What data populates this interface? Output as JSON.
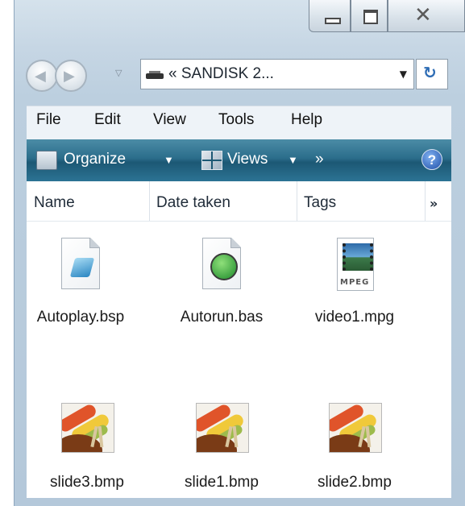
{
  "window": {
    "caption_buttons": {
      "minimize_icon": "minimize-icon",
      "maximize_icon": "maximize-icon",
      "close_icon": "close-icon"
    }
  },
  "navigation": {
    "back_icon": "back-arrow-icon",
    "forward_icon": "forward-arrow-icon",
    "address": {
      "prefix": "«",
      "location": "SANDISK 2...",
      "drive_icon": "removable-drive-icon"
    },
    "refresh_icon": "refresh-icon"
  },
  "menu": {
    "items": [
      "File",
      "Edit",
      "View",
      "Tools",
      "Help"
    ]
  },
  "toolbar": {
    "organize_label": "Organize",
    "views_label": "Views",
    "more_label": "»",
    "help_label": "?",
    "colors": {
      "gradient_top": "#4b8ca6",
      "gradient_bottom": "#1c5874"
    }
  },
  "columns": {
    "headers": [
      "Name",
      "Date taken",
      "Tags"
    ],
    "more": "»"
  },
  "files": [
    {
      "name": "Autoplay.bsp",
      "icon": "document-icon"
    },
    {
      "name": "Autorun.bas",
      "icon": "script-icon"
    },
    {
      "name": "video1.mpg",
      "icon": "mpeg-video-icon",
      "icon_label": "MPEG"
    },
    {
      "name": "slide3.bmp",
      "icon": "bitmap-image-icon"
    },
    {
      "name": "slide1.bmp",
      "icon": "bitmap-image-icon"
    },
    {
      "name": "slide2.bmp",
      "icon": "bitmap-image-icon"
    }
  ]
}
